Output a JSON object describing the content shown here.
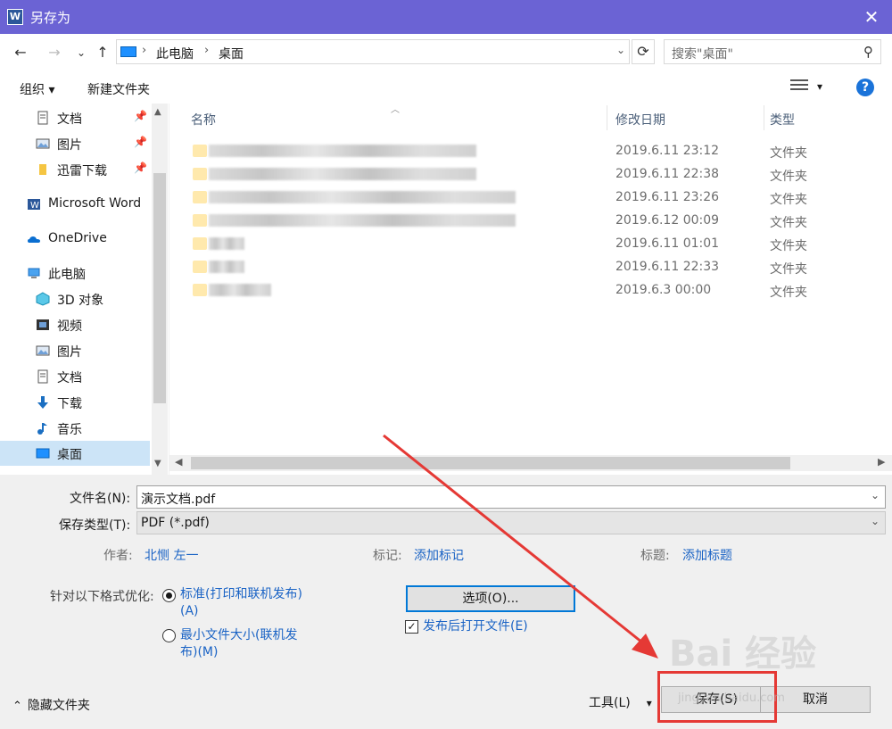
{
  "window": {
    "title": "另存为",
    "close": "✕"
  },
  "nav": {
    "back": "←",
    "forward": "→",
    "recent": "⌄",
    "up": "↑",
    "path": [
      "此电脑",
      "桌面"
    ],
    "refresh": "⟳",
    "search_placeholder": "搜索\"桌面\"",
    "search_icon": "⚲"
  },
  "commands": {
    "organize": "组织 ▾",
    "new_folder": "新建文件夹",
    "view_dropdown": "▾",
    "help": "?"
  },
  "sidebar": {
    "items": [
      {
        "label": "文档",
        "icon": "document-icon",
        "pinned": true
      },
      {
        "label": "图片",
        "icon": "picture-icon",
        "pinned": true
      },
      {
        "label": "迅雷下载",
        "icon": "folder-icon",
        "pinned": true
      },
      {
        "label": "Microsoft Word",
        "icon": "word-icon"
      },
      {
        "label": "OneDrive",
        "icon": "onedrive-icon"
      },
      {
        "label": "此电脑",
        "icon": "computer-icon"
      },
      {
        "label": "3D 对象",
        "icon": "cube-icon"
      },
      {
        "label": "视频",
        "icon": "video-icon"
      },
      {
        "label": "图片",
        "icon": "picture-icon"
      },
      {
        "label": "文档",
        "icon": "document-icon"
      },
      {
        "label": "下载",
        "icon": "download-icon"
      },
      {
        "label": "音乐",
        "icon": "music-icon"
      },
      {
        "label": "桌面",
        "icon": "desktop-icon",
        "selected": true
      }
    ],
    "pin_glyph": "📌"
  },
  "files": {
    "columns": [
      "名称",
      "修改日期",
      "类型"
    ],
    "rows": [
      {
        "date": "2019.6.11 23:12",
        "type": "文件夹"
      },
      {
        "date": "2019.6.11 22:38",
        "type": "文件夹"
      },
      {
        "date": "2019.6.11 23:26",
        "type": "文件夹"
      },
      {
        "date": "2019.6.12 00:09",
        "type": "文件夹"
      },
      {
        "date": "2019.6.11 01:01",
        "type": "文件夹"
      },
      {
        "date": "2019.6.11 22:33",
        "type": "文件夹"
      },
      {
        "date": "2019.6.3 00:00",
        "type": "文件夹"
      }
    ]
  },
  "form": {
    "filename_label": "文件名(N):",
    "filename_value": "演示文档.pdf",
    "type_label": "保存类型(T):",
    "type_value": "PDF (*.pdf)",
    "author_key": "作者:",
    "author_value": "北恻 左一",
    "tags_key": "标记:",
    "tags_value": "添加标记",
    "title_key": "标题:",
    "title_value": "添加标题",
    "optimize_label": "针对以下格式优化:",
    "opt_standard": "标准(打印和联机发布)",
    "opt_standard_key": "(A)",
    "opt_min": "最小文件大小(联机发",
    "opt_min_key": "布)(M)",
    "options_button": "选项(O)...",
    "open_after": "发布后打开文件(E)",
    "open_after_checked": true
  },
  "footer": {
    "hide_folders": "隐藏文件夹",
    "tools": "工具(L)",
    "tools_arrow": "▾",
    "save": "保存(S)",
    "cancel": "取消"
  },
  "watermark": {
    "brand": "Bai 经验",
    "url": "jingyan.baidu.com"
  },
  "colors": {
    "titlebar": "#6b63d4",
    "accent": "#0078d7",
    "link": "#1a63c5",
    "annotation": "#e53935"
  }
}
